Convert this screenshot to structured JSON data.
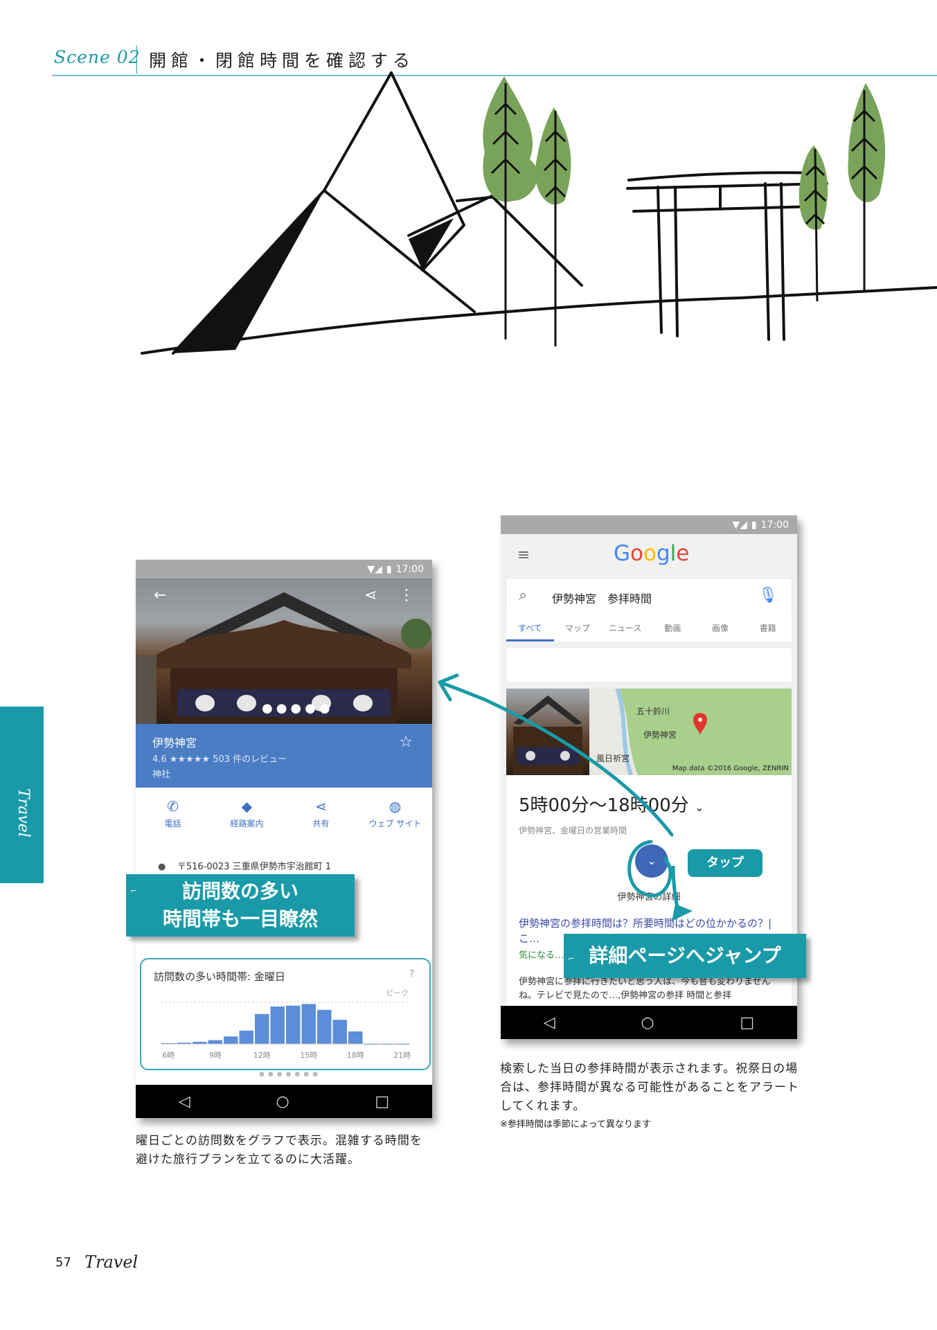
{
  "header": {
    "scene": "Scene 02",
    "title": "開館・閉館時間を確認する"
  },
  "side_tab": {
    "label": "Travel"
  },
  "left_phone": {
    "status_time": "17:00",
    "place": {
      "name": "伊勢神宮",
      "rating_text": "4.6 ★★★★★ 503 件のレビュー",
      "type": "神社"
    },
    "actions": [
      {
        "label": "電話",
        "icon": "phone-icon"
      },
      {
        "label": "経路案内",
        "icon": "directions-icon"
      },
      {
        "label": "共有",
        "icon": "share-icon"
      },
      {
        "label": "ウェブ サイト",
        "icon": "globe-icon"
      }
    ],
    "address": "〒516-0023 三重県伊勢市宇治館町 1",
    "popular_times": {
      "title": "訪問数の多い時間帯: 金曜日",
      "peak_label": "ピーク"
    }
  },
  "right_phone": {
    "status_time": "17:00",
    "logo": [
      "G",
      "o",
      "o",
      "g",
      "l",
      "e"
    ],
    "search_query": "伊勢神宮　参拝時間",
    "tabs": [
      "すべて",
      "マップ",
      "ニュース",
      "動画",
      "画像",
      "書籍"
    ],
    "map_labels": {
      "river": "五十鈴川",
      "shrine": "伊勢神宮",
      "other": "風日祈宮",
      "credit": "Map data ©2016 Google, ZENRIN"
    },
    "hours": "5時00分〜18時00分",
    "hours_sub": "伊勢神宮、金曜日の営業時間",
    "detail_label": "伊勢神宮の詳細",
    "result": {
      "title": "伊勢神宮の参拝時間は？所要時間はどの位かかるの？|こ…",
      "green": "気になる…",
      "snippet": "伊勢神宮に参拝に行きたいと思う人は、今も昔も変わりませんね。テレビで見たので…,伊勢神宮の参拝 時間と参拝"
    }
  },
  "callouts": {
    "visits_line1": "訪問数の多い",
    "visits_line2": "時間帯も一目瞭然",
    "jump": "詳細ページへジャンプ",
    "tap": "タップ"
  },
  "captions": {
    "left": "曜日ごとの訪問数をグラフで表示。混雑する時間を避けた旅行プランを立てるのに大活躍。",
    "right": "検索した当日の参拝時間が表示されます。祝祭日の場合は、参拝時間が異なる可能性があることをアラートしてくれます。",
    "note": "※参拝時間は季節によって異なります"
  },
  "footer": {
    "page": "57",
    "section": "Travel"
  },
  "chart_data": {
    "type": "bar",
    "title": "訪問数の多い時間帯: 金曜日",
    "categories": [
      "6時",
      "7時",
      "8時",
      "9時",
      "10時",
      "11時",
      "12時",
      "13時",
      "14時",
      "15時",
      "16時",
      "17時",
      "18時",
      "19時",
      "20時",
      "21時"
    ],
    "values": [
      2,
      3,
      5,
      9,
      18,
      32,
      72,
      90,
      92,
      96,
      82,
      58,
      30,
      0,
      0,
      0
    ],
    "tick_labels": [
      "6時",
      "9時",
      "12時",
      "15時",
      "18時",
      "21時"
    ],
    "tick_positions": [
      0,
      3,
      6,
      9,
      12,
      15
    ],
    "ylim": [
      0,
      100
    ],
    "colors": {
      "bar": "#5b8ed8"
    }
  }
}
